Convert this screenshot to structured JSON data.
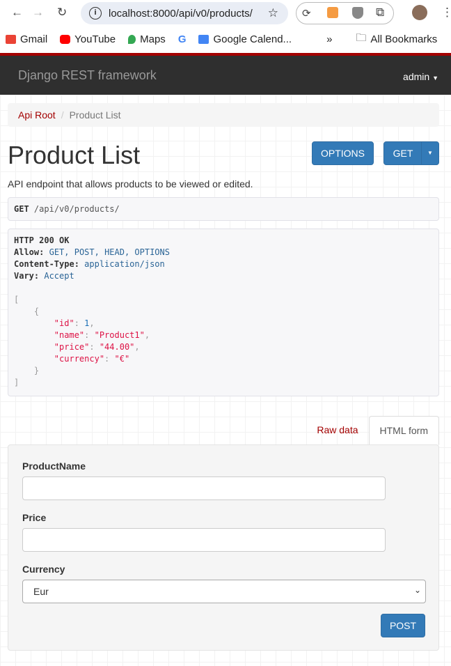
{
  "browser": {
    "url": "localhost:8000/api/v0/products/",
    "bookmarks": [
      "Gmail",
      "YouTube",
      "Maps",
      "Google Calend...",
      "All Bookmarks"
    ]
  },
  "navbar": {
    "brand": "Django REST framework",
    "user": "admin"
  },
  "breadcrumb": {
    "root": "Api Root",
    "current": "Product List"
  },
  "page": {
    "title": "Product List",
    "description": "API endpoint that allows products to be viewed or edited.",
    "options_label": "OPTIONS",
    "get_label": "GET"
  },
  "request": {
    "method": "GET",
    "path": "/api/v0/products/"
  },
  "response": {
    "status": "HTTP 200 OK",
    "allow_key": "Allow:",
    "allow": "GET, POST, HEAD, OPTIONS",
    "ct_key": "Content-Type:",
    "ct": "application/json",
    "vary_key": "Vary:",
    "vary": "Accept",
    "items": [
      {
        "id": "1",
        "name": "\"Product1\"",
        "price": "\"44.00\"",
        "currency": "\"€\""
      }
    ]
  },
  "tabs": [
    {
      "label": "Raw data"
    },
    {
      "label": "HTML form"
    }
  ],
  "form": {
    "name_label": "ProductName",
    "price_label": "Price",
    "currency_label": "Currency",
    "currency_value": "Eur",
    "submit": "POST"
  },
  "colors": {
    "accent": "#a30000",
    "primary": "#337ab7",
    "navbar": "#2f2f2f"
  }
}
